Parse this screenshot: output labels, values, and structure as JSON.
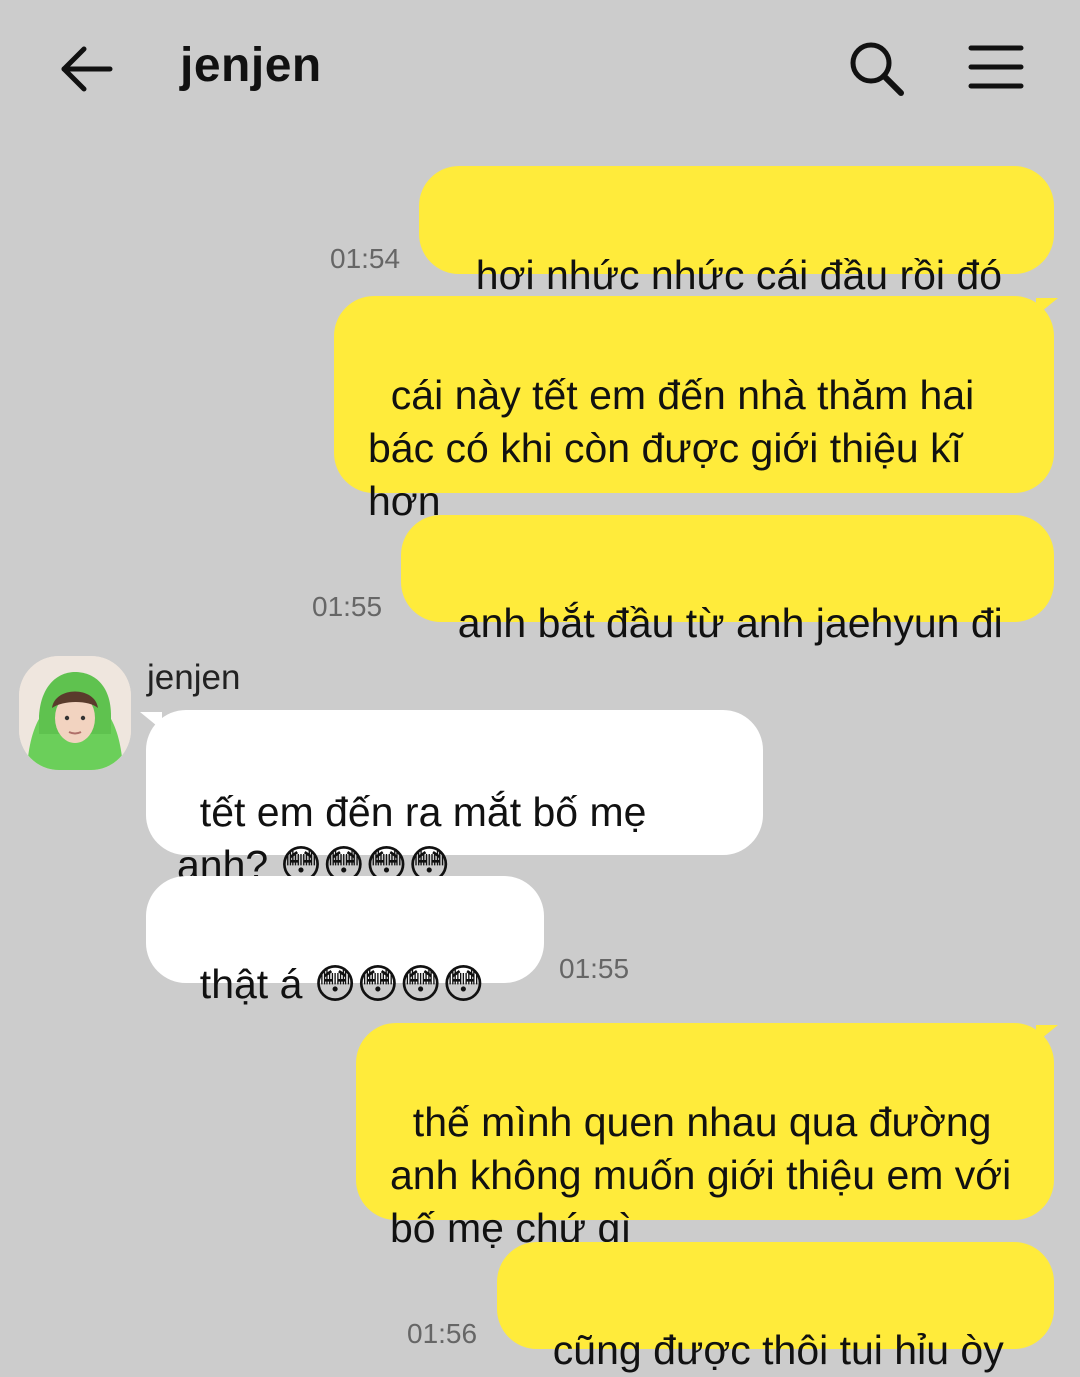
{
  "header": {
    "title": "jenjen",
    "back_icon": "arrow-left-icon",
    "search_icon": "search-icon",
    "menu_icon": "hamburger-menu-icon"
  },
  "colors": {
    "background": "#cccccc",
    "outgoing_bubble": "#ffeb3b",
    "incoming_bubble": "#ffffff"
  },
  "messages": [
    {
      "direction": "out",
      "text": "hơi nhức nhức cái đầu rồi đó",
      "time": "01:54"
    },
    {
      "direction": "out",
      "text": "cái này tết em đến nhà thăm hai bác có khi còn được giới thiệu kĩ hơn"
    },
    {
      "direction": "out",
      "text": "anh bắt đầu từ anh jaehyun đi",
      "time": "01:55"
    },
    {
      "direction": "in",
      "sender": "jenjen",
      "text": "tết em đến ra mắt bố mẹ anh? 😳😳😳😳"
    },
    {
      "direction": "in",
      "text": "thật á 😳😳😳😳",
      "time": "01:55"
    },
    {
      "direction": "out",
      "text": "thế mình quen nhau qua đường anh không muốn giới thiệu em với bố mẹ chứ gì"
    },
    {
      "direction": "out",
      "text": "cũng được thôi tui hỉu òy",
      "time": "01:56"
    }
  ]
}
